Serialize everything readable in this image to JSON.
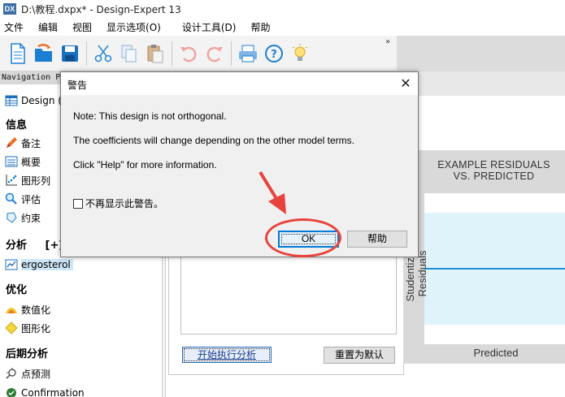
{
  "window": {
    "logo_text": "DX",
    "title": "D:\\教程.dxpx* - Design-Expert 13"
  },
  "menu": {
    "items": [
      "文件",
      "编辑",
      "视图",
      "显示选项(O)",
      "设计工具(D)",
      "帮助"
    ]
  },
  "toolbar": {
    "buttons": [
      "new-file-icon",
      "open-folder-icon",
      "save-icon",
      "cut-icon",
      "copy-icon",
      "paste-icon",
      "undo-icon",
      "redo-icon",
      "print-icon",
      "help-icon",
      "tip-bulb-icon"
    ],
    "overflow": "»"
  },
  "nav": {
    "header": "Navigation P",
    "design_item": "Design (A",
    "section_info": "信息",
    "notes": "备注",
    "summary": "概要",
    "graph_columns": "图形列",
    "evaluation": "评估",
    "constraints": "约束",
    "section_analysis": "分析",
    "analysis_add": "[+]",
    "analysis_item": "ergosterol",
    "section_optimization": "优化",
    "numerical": "数值化",
    "graphical": "图形化",
    "section_post": "后期分析",
    "point_prediction": "点预测",
    "confirmation": "Confirmation"
  },
  "main": {
    "run_analysis": "开始执行分析",
    "reset_default": "重置为默认"
  },
  "example_chart": {
    "title_line1": "EXAMPLE RESIDUALS",
    "title_line2": "VS. PREDICTED",
    "xlabel": "Predicted",
    "ylabel": "Studentized Residuals",
    "colors": {
      "band": "#dff3fb",
      "line": "#1f8fd6",
      "frame": "#d9d9d9"
    }
  },
  "dialog": {
    "title": "警告",
    "close": "✕",
    "message_1": "Note: This design is not orthogonal.",
    "message_2": "The coefficients will change depending on the other model terms.",
    "message_3": "Click \"Help\" for more information.",
    "dont_show": "不再显示此警告。",
    "ok": "OK",
    "help": "帮助"
  },
  "annotation": {
    "color": "#e8423c"
  }
}
